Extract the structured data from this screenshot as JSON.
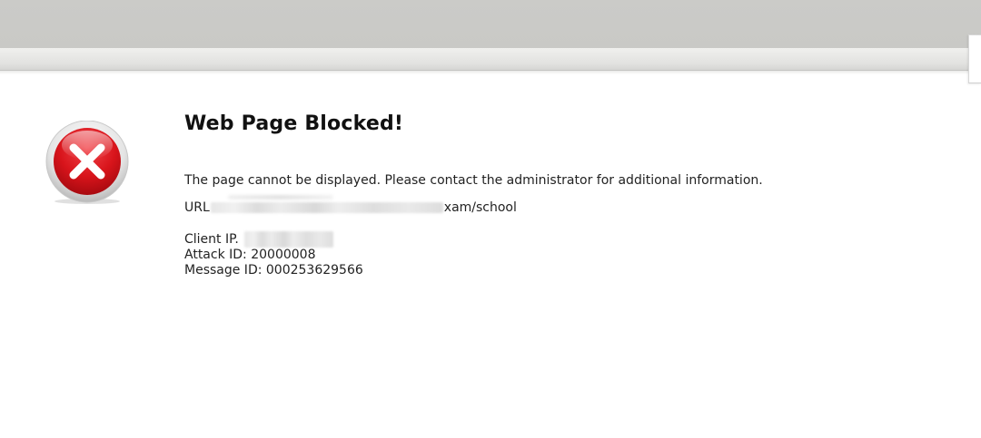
{
  "page": {
    "title": "Web Page Blocked!",
    "message": "The page cannot be displayed. Please contact the administrator for additional information.",
    "url_label": "URL",
    "url_visible_suffix": "xam/school",
    "client_ip_label": "Client IP.",
    "attack_id_label": "Attack ID:",
    "attack_id": "20000008",
    "message_id_label": "Message ID:",
    "message_id": "000253629566"
  },
  "icons": {
    "error": "error-x-icon"
  },
  "colors": {
    "error_red": "#d81a1f",
    "chrome_gray": "#cacac7",
    "text": "#222222"
  }
}
